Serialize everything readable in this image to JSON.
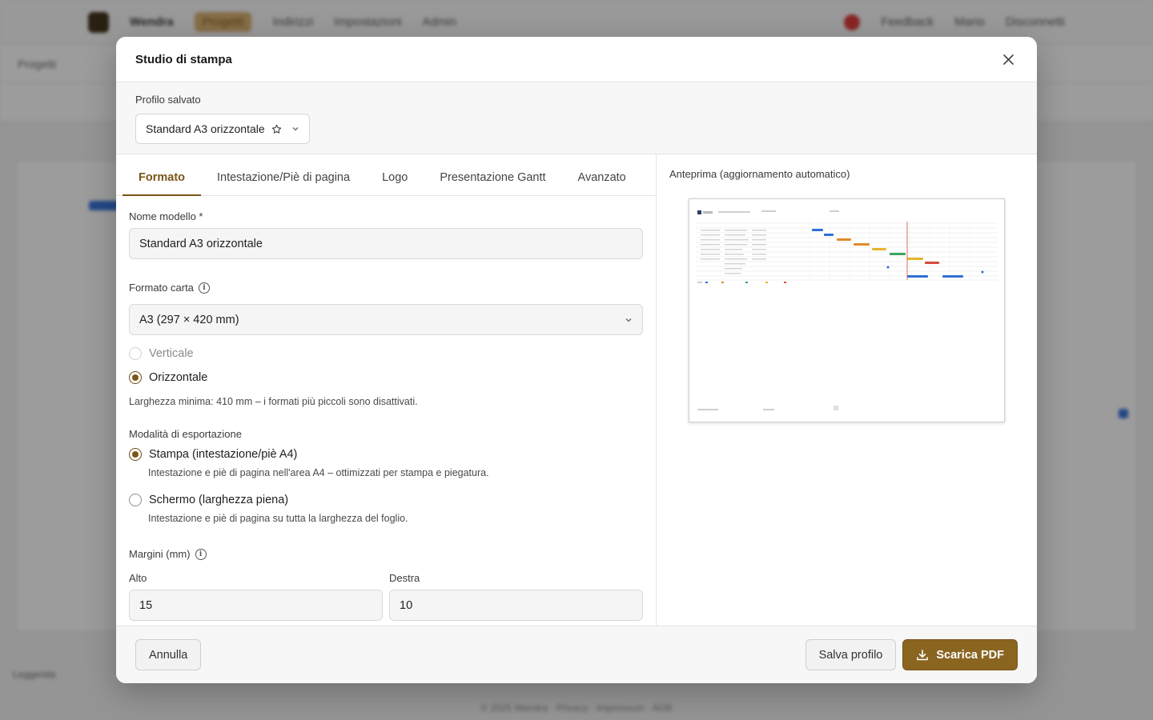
{
  "background": {
    "brand": "Wendra",
    "nav": [
      "Progetti",
      "Indirizzi",
      "Impostazioni",
      "Admin"
    ],
    "right_nav": [
      "Feedback",
      "Mario",
      "Disconnetti"
    ],
    "breadcrumb": "Progetti",
    "legend_title": "Leggenda",
    "footer": "© 2025 Wendra · Privacy · Impressum · AGB"
  },
  "modal": {
    "title": "Studio di stampa",
    "profile": {
      "label": "Profilo salvato",
      "value": "Standard A3 orizzontale"
    },
    "tabs": [
      "Formato",
      "Intestazione/Piè di pagina",
      "Logo",
      "Presentazione Gantt",
      "Avanzato"
    ],
    "active_tab": "Formato",
    "form": {
      "template_name_label": "Nome modello *",
      "template_name_value": "Standard A3 orizzontale",
      "paper_format_label": "Formato carta",
      "paper_format_value": "A3 (297 × 420 mm)",
      "orientation_options": [
        {
          "label": "Verticale",
          "checked": false,
          "disabled": true
        },
        {
          "label": "Orizzontale",
          "checked": true,
          "disabled": false
        }
      ],
      "orientation_hint": "Larghezza minima: 410 mm – i formati più piccoli sono disattivati.",
      "export_mode_label": "Modalità di esportazione",
      "export_modes": [
        {
          "label": "Stampa (intestazione/piè A4)",
          "description": "Intestazione e piè di pagina nell'area A4 – ottimizzati per stampa e piegatura.",
          "checked": true
        },
        {
          "label": "Schermo (larghezza piena)",
          "description": "Intestazione e piè di pagina su tutta la larghezza del foglio.",
          "checked": false
        }
      ],
      "margins_label": "Margini (mm)",
      "margin_top_label": "Alto",
      "margin_top_value": "15",
      "margin_right_label": "Destra",
      "margin_right_value": "10"
    },
    "preview": {
      "label": "Anteprima (aggiornamento automatico)"
    },
    "footer": {
      "cancel": "Annulla",
      "save_profile": "Salva profilo",
      "download": "Scarica PDF"
    }
  },
  "colors": {
    "accent": "#7a5518",
    "primary_button": "#8a6520",
    "overlay": "rgba(20,20,20,0.42)"
  }
}
